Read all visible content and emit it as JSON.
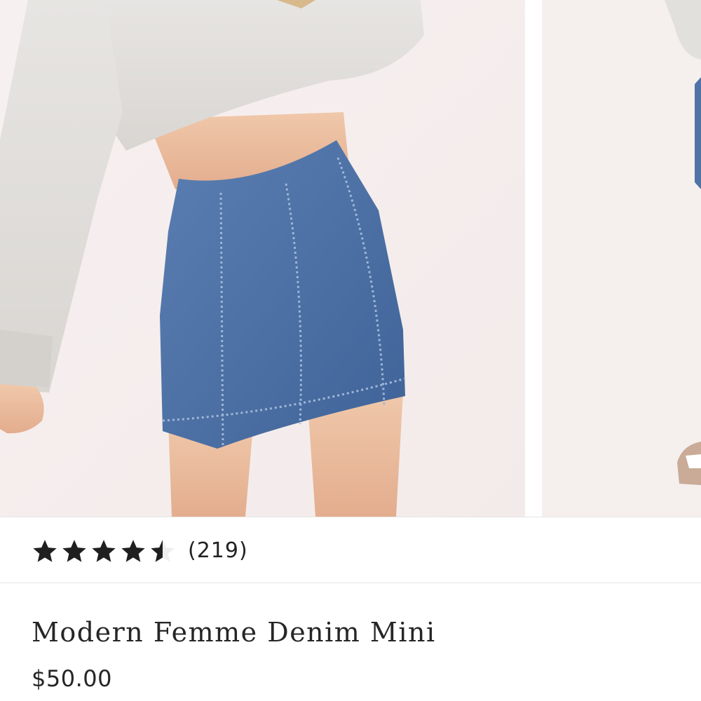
{
  "product": {
    "title": "Modern Femme Denim Mini",
    "price": "$50.00",
    "rating": {
      "value": 4.5,
      "max": 5,
      "review_count": "(219)",
      "star_color": "#1f1f1f",
      "empty_star_color": "#d9d9d9"
    }
  },
  "gallery": {
    "images": [
      {
        "icon": "product-photo-front",
        "subject": "denim mini skirt with cropped grey sweatshirt"
      },
      {
        "icon": "product-photo-next",
        "subject": "partial second product photo"
      }
    ],
    "colors": {
      "background": "#f6efef",
      "denim": "#4f73a6",
      "sweatshirt": "#e2e0dd",
      "skin": "#e8b898"
    }
  }
}
